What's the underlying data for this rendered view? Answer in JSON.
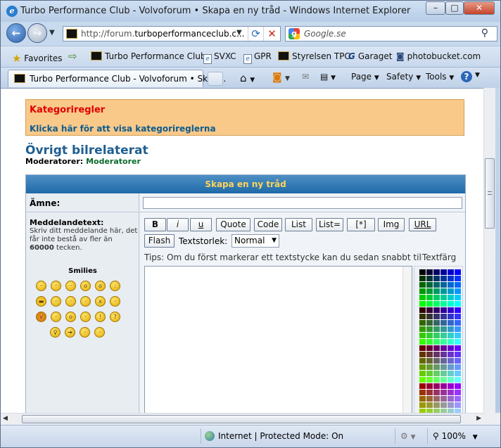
{
  "window": {
    "title": "Turbo Performance Club - Volvoforum • Skapa en ny tråd - Windows Internet Explorer"
  },
  "address": {
    "url_prefix": "http://forum.",
    "url_domain": "turboperformanceclub.c...",
    "search_placeholder": "Google.se"
  },
  "favorites": {
    "label": "Favorites",
    "items": [
      "Turbo Performance Club",
      "SVXC",
      "GPR",
      "Styrelsen TPC",
      "Garaget",
      "photobucket.com"
    ]
  },
  "tab": {
    "label": "Turbo Performance Club - Volvoforum • Skap..."
  },
  "commands": {
    "page": "Page",
    "safety": "Safety",
    "tools": "Tools"
  },
  "page": {
    "category_title": "Kategoriregler",
    "category_link": "Klicka här för att visa kategorireglerna",
    "forum_title": "Övrigt bilrelaterat",
    "moderators_label": "Moderatorer:",
    "moderators_value": "Moderatorer",
    "form_title": "Skapa en ny tråd",
    "subject_label": "Ämne:",
    "message_label": "Meddelandetext:",
    "message_help_1": "Skriv ditt meddelande här, det får inte bestå av fler än",
    "message_help_count": "60000",
    "message_help_2": "tecken.",
    "smilies_title": "Smilies",
    "buttons": {
      "bold": "B",
      "italic": "i",
      "underline": "u",
      "quote": "Quote",
      "code": "Code",
      "list": "List",
      "list_eq": "List=",
      "star": "[*]",
      "img": "Img",
      "url": "URL",
      "flash": "Flash"
    },
    "text_size_label": "Textstorlek:",
    "text_size_value": "Normal",
    "tips": "Tips: Om du först markerar ett textstycke kan du sedan snabbt tillä",
    "text_color_label": "Textfärg"
  },
  "status": {
    "zone": "Internet | Protected Mode: On",
    "zoom": "100%"
  },
  "palette_colors": [
    "#000000",
    "#000033",
    "#000066",
    "#000099",
    "#0000cc",
    "#0000ff",
    "#003300",
    "#003333",
    "#003366",
    "#003399",
    "#0033cc",
    "#0033ff",
    "#006600",
    "#006633",
    "#006666",
    "#006699",
    "#0066cc",
    "#0066ff",
    "#009900",
    "#009933",
    "#009966",
    "#009999",
    "#0099cc",
    "#0099ff",
    "#00cc00",
    "#00cc33",
    "#00cc66",
    "#00cc99",
    "#00cccc",
    "#00ccff",
    "#00ff00",
    "#00ff33",
    "#00ff66",
    "#00ff99",
    "#00ffcc",
    "#00ffff",
    "#330000",
    "#330033",
    "#330066",
    "#330099",
    "#3300cc",
    "#3300ff",
    "#333300",
    "#333333",
    "#333366",
    "#333399",
    "#3333cc",
    "#3333ff",
    "#336600",
    "#336633",
    "#336666",
    "#336699",
    "#3366cc",
    "#3366ff",
    "#339900",
    "#339933",
    "#339966",
    "#339999",
    "#3399cc",
    "#3399ff",
    "#33cc00",
    "#33cc33",
    "#33cc66",
    "#33cc99",
    "#33cccc",
    "#33ccff",
    "#33ff00",
    "#33ff33",
    "#33ff66",
    "#33ff99",
    "#33ffcc",
    "#33ffff",
    "#660000",
    "#660033",
    "#660066",
    "#660099",
    "#6600cc",
    "#6600ff",
    "#663300",
    "#663333",
    "#663366",
    "#663399",
    "#6633cc",
    "#6633ff",
    "#666600",
    "#666633",
    "#666666",
    "#666699",
    "#6666cc",
    "#6666ff",
    "#669900",
    "#669933",
    "#669966",
    "#669999",
    "#6699cc",
    "#6699ff",
    "#66cc00",
    "#66cc33",
    "#66cc66",
    "#66cc99",
    "#66cccc",
    "#66ccff",
    "#66ff00",
    "#66ff33",
    "#66ff66",
    "#66ff99",
    "#66ffcc",
    "#66ffff",
    "#990000",
    "#990033",
    "#990066",
    "#990099",
    "#9900cc",
    "#9900ff",
    "#993300",
    "#993333",
    "#993366",
    "#993399",
    "#9933cc",
    "#9933ff",
    "#996600",
    "#996633",
    "#996666",
    "#996699",
    "#9966cc",
    "#9966ff",
    "#999900",
    "#999933",
    "#999966",
    "#999999",
    "#9999cc",
    "#9999ff",
    "#99cc00",
    "#99cc33",
    "#99cc66",
    "#99cc99",
    "#99cccc",
    "#99ccff"
  ]
}
